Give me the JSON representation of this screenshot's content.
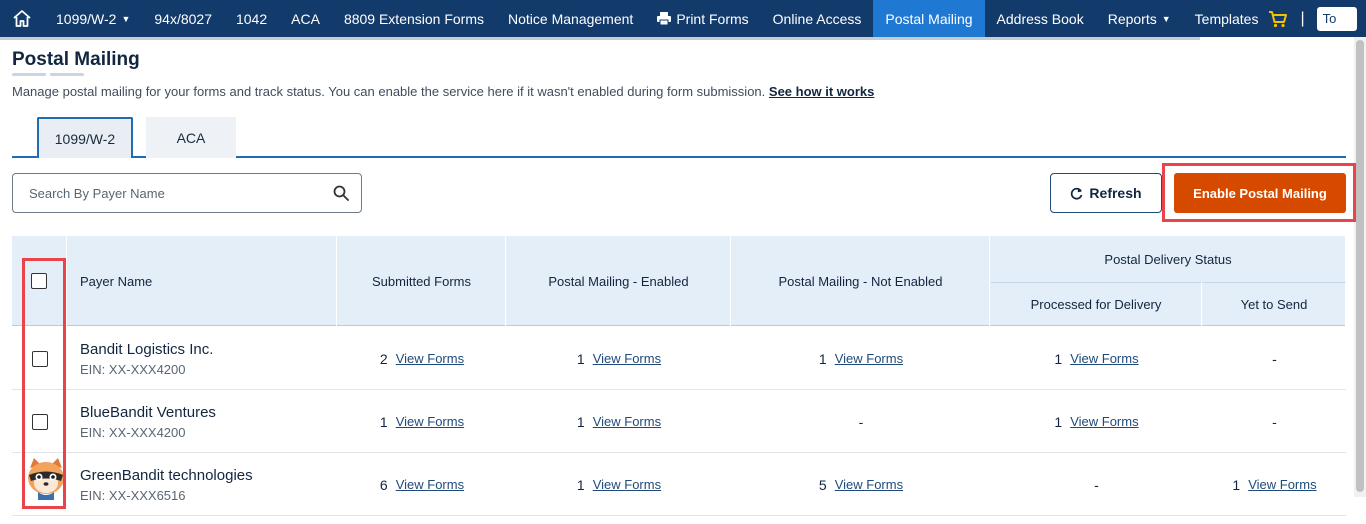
{
  "nav": {
    "items": [
      {
        "label": "1099/W-2",
        "caret": true
      },
      {
        "label": "94x/8027"
      },
      {
        "label": "1042"
      },
      {
        "label": "ACA"
      },
      {
        "label": "8809 Extension Forms"
      },
      {
        "label": "Notice Management"
      },
      {
        "label": "Print Forms",
        "icon": "printer-icon"
      },
      {
        "label": "Online Access"
      },
      {
        "label": "Postal Mailing",
        "active": true
      },
      {
        "label": "Address Book"
      },
      {
        "label": "Reports",
        "caret": true
      },
      {
        "label": "Templates"
      }
    ],
    "separator": "|",
    "truncated_box": "To"
  },
  "page": {
    "title": "Postal Mailing",
    "description": "Manage postal mailing for your forms and track status. You can enable the service here if it wasn't enabled during form submission.",
    "how_link": "See how it works"
  },
  "tabs": [
    {
      "label": "1099/W-2",
      "active": true
    },
    {
      "label": "ACA"
    }
  ],
  "search": {
    "placeholder": "Search By Payer Name"
  },
  "actions": {
    "refresh": "Refresh",
    "enable": "Enable Postal Mailing"
  },
  "table": {
    "headers": {
      "payer": "Payer Name",
      "submitted": "Submitted Forms",
      "enabled": "Postal Mailing - Enabled",
      "not_enabled": "Postal Mailing - Not Enabled",
      "status_group": "Postal Delivery Status",
      "processed": "Processed for Delivery",
      "yet": "Yet to Send"
    },
    "view_label": "View Forms",
    "rows": [
      {
        "name": "Bandit Logistics Inc.",
        "ein": "EIN: XX-XXX4200",
        "submitted": "2",
        "enabled": "1",
        "not_enabled": "1",
        "processed": "1",
        "yet": "-"
      },
      {
        "name": "BlueBandit Ventures",
        "ein": "EIN: XX-XXX4200",
        "submitted": "1",
        "enabled": "1",
        "not_enabled": "-",
        "processed": "1",
        "yet": "-"
      },
      {
        "name": "GreenBandit technologies",
        "ein": "EIN: XX-XXX6516",
        "submitted": "6",
        "enabled": "1",
        "not_enabled": "5",
        "processed": "-",
        "yet": "1"
      }
    ]
  },
  "colors": {
    "nav_bg": "#123a6b",
    "nav_active": "#1f78d1",
    "accent_orange": "#d64a00",
    "highlight_red": "#e8444a",
    "header_bg": "#e4eef9",
    "cart_icon": "#f2c200"
  }
}
